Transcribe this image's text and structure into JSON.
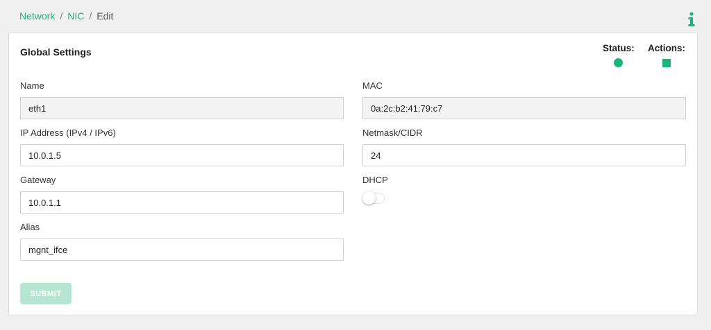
{
  "breadcrumb": {
    "items": [
      {
        "label": "Network",
        "link": true
      },
      {
        "label": "NIC",
        "link": true
      },
      {
        "label": "Edit",
        "link": false
      }
    ],
    "separator": "/"
  },
  "header": {
    "info_icon": "info-icon",
    "accent_color": "#1bb47a"
  },
  "card": {
    "title": "Global Settings",
    "status_label": "Status:",
    "actions_label": "Actions:",
    "status_icon": "status-dot-icon",
    "actions_icon": "stop-square-icon"
  },
  "form": {
    "name": {
      "label": "Name",
      "value": "eth1"
    },
    "mac": {
      "label": "MAC",
      "value": "0a:2c:b2:41:79:c7"
    },
    "ip": {
      "label": "IP Address (IPv4 / IPv6)",
      "value": "10.0.1.5"
    },
    "netmask": {
      "label": "Netmask/CIDR",
      "value": "24"
    },
    "gateway": {
      "label": "Gateway",
      "value": "10.0.1.1"
    },
    "dhcp": {
      "label": "DHCP",
      "enabled": false
    },
    "alias": {
      "label": "Alias",
      "value": "mgnt_ifce"
    },
    "submit_label": "SUBMIT"
  }
}
